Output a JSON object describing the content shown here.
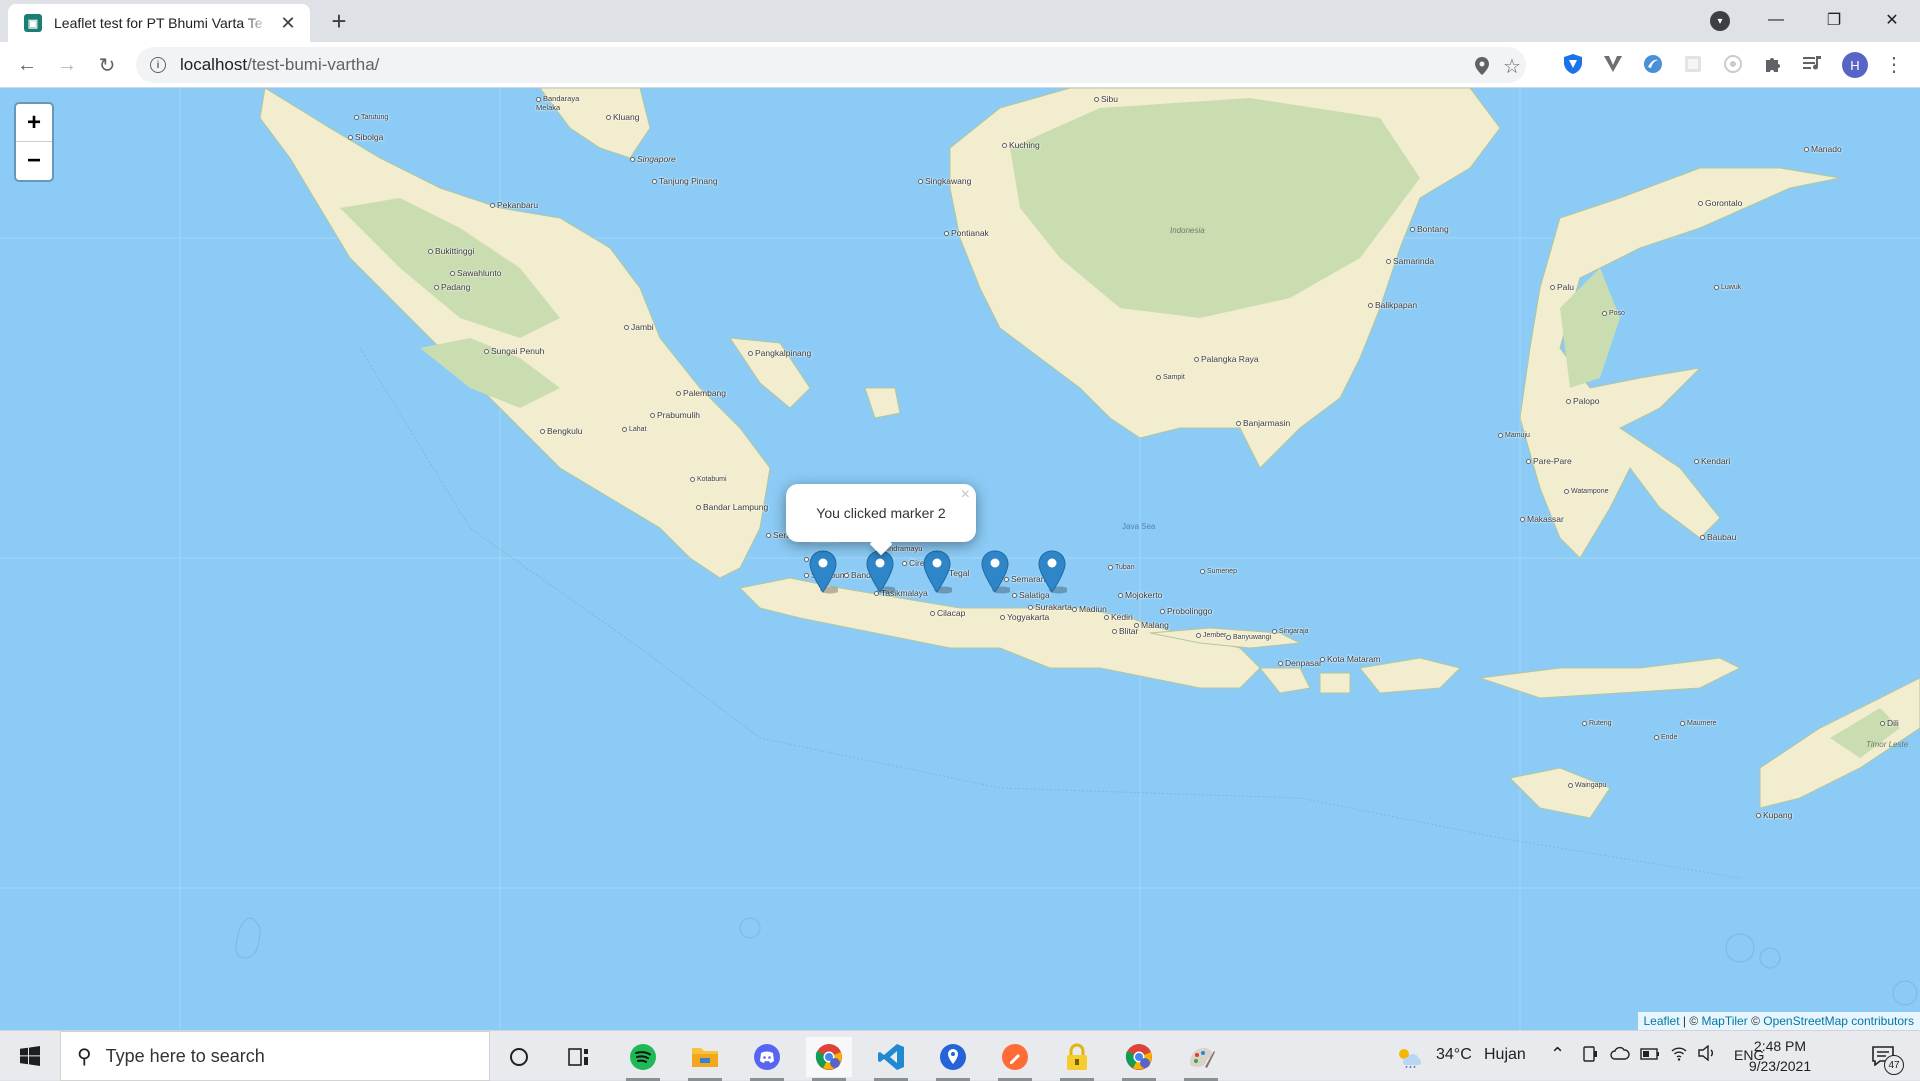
{
  "browser": {
    "tab_title": "Leaflet test for PT Bhumi Varta Te",
    "url_host": "localhost",
    "url_path": "/test-bumi-vartha/",
    "profile_initial": "H"
  },
  "map": {
    "zoom_in_label": "+",
    "zoom_out_label": "−",
    "popup_text": "You clicked marker 2",
    "popup_close": "×",
    "attribution": {
      "leaflet": "Leaflet",
      "sep": " | © ",
      "maptiler": "MapTiler",
      "sep2": " © ",
      "osm": "OpenStreetMap contributors"
    },
    "markers": [
      "marker-1",
      "marker-2",
      "marker-3",
      "marker-4",
      "marker-5"
    ],
    "places": {
      "bandaraya_melaka": "Bandaraya\nMelaka",
      "kluang": "Kluang",
      "sibolga": "Sibolga",
      "tarutung": "Tarutung",
      "singapore": "Singapore",
      "tanjung_pinang": "Tanjung Pinang",
      "pekanbaru": "Pekanbaru",
      "bukittinggi": "Bukittinggi",
      "sawahlunto": "Sawahlunto",
      "padang": "Padang",
      "jambi": "Jambi",
      "sungai_penuh": "Sungai Penuh",
      "pangkalpinang": "Pangkalpinang",
      "palembang": "Palembang",
      "prabumulih": "Prabumulih",
      "lahat": "Lahat",
      "bengkulu": "Bengkulu",
      "kotabumi": "Kotabumi",
      "bandar_lampung": "Bandar Lampung",
      "serang": "Serang",
      "jakarta": "Jakarta",
      "bogor": "Bogor",
      "sukabumi": "Sukabumi",
      "bandung": "Bandung",
      "indramayu": "Indramayu",
      "cirebon": "Cirebon",
      "tegal": "Tegal",
      "tasikmalaya": "Tasikmalaya",
      "cilacap": "Cilacap",
      "semarang": "Semarang",
      "salatiga": "Salatiga",
      "surakarta": "Surakarta",
      "yogyakarta": "Yogyakarta",
      "madiun": "Madiun",
      "kediri": "Kediri",
      "blitar": "Blitar",
      "mojokerto": "Mojokerto",
      "malang": "Malang",
      "probolinggo": "Probolinggo",
      "jember": "Jember",
      "banyuwangi": "Banyuwangi",
      "tuban": "Tuban",
      "sumenep": "Sumenep",
      "singaraja": "Singaraja",
      "denpasar": "Denpasar",
      "kota_mataram": "Kota Mataram",
      "sibu": "Sibu",
      "kuching": "Kuching",
      "singkawang": "Singkawang",
      "pontianak": "Pontianak",
      "indonesia": "Indonesia",
      "palangka_raya": "Palangka Raya",
      "sampit": "Sampit",
      "banjarmasin": "Banjarmasin",
      "bontang": "Bontang",
      "samarinda": "Samarinda",
      "balikpapan": "Balikpapan",
      "manado": "Manado",
      "gorontalo": "Gorontalo",
      "palu": "Palu",
      "luwuk": "Luwuk",
      "poso": "Poso",
      "palopo": "Palopo",
      "mamuju": "Mamuju",
      "pare_pare": "Pare-Pare",
      "watampone": "Watampone",
      "kendari": "Kendari",
      "makassar": "Makassar",
      "baubau": "Baubau",
      "java_sea": "Java Sea",
      "ruteng": "Ruteng",
      "maumere": "Maumere",
      "ende": "Ende",
      "waingapu": "Waingapu",
      "kupang": "Kupang",
      "dili": "Dili",
      "timor_leste": "Timor Leste"
    }
  },
  "taskbar": {
    "search_placeholder": "Type here to search",
    "weather_temp": "34°C",
    "weather_text": "Hujan",
    "language": "ENG",
    "time": "2:48 PM",
    "date": "9/23/2021",
    "notification_count": "47"
  },
  "colors": {
    "sea": "#8bcbf5",
    "land": "#f3edcf",
    "forest": "#c9ddb0",
    "marker": "#2e86c9"
  }
}
